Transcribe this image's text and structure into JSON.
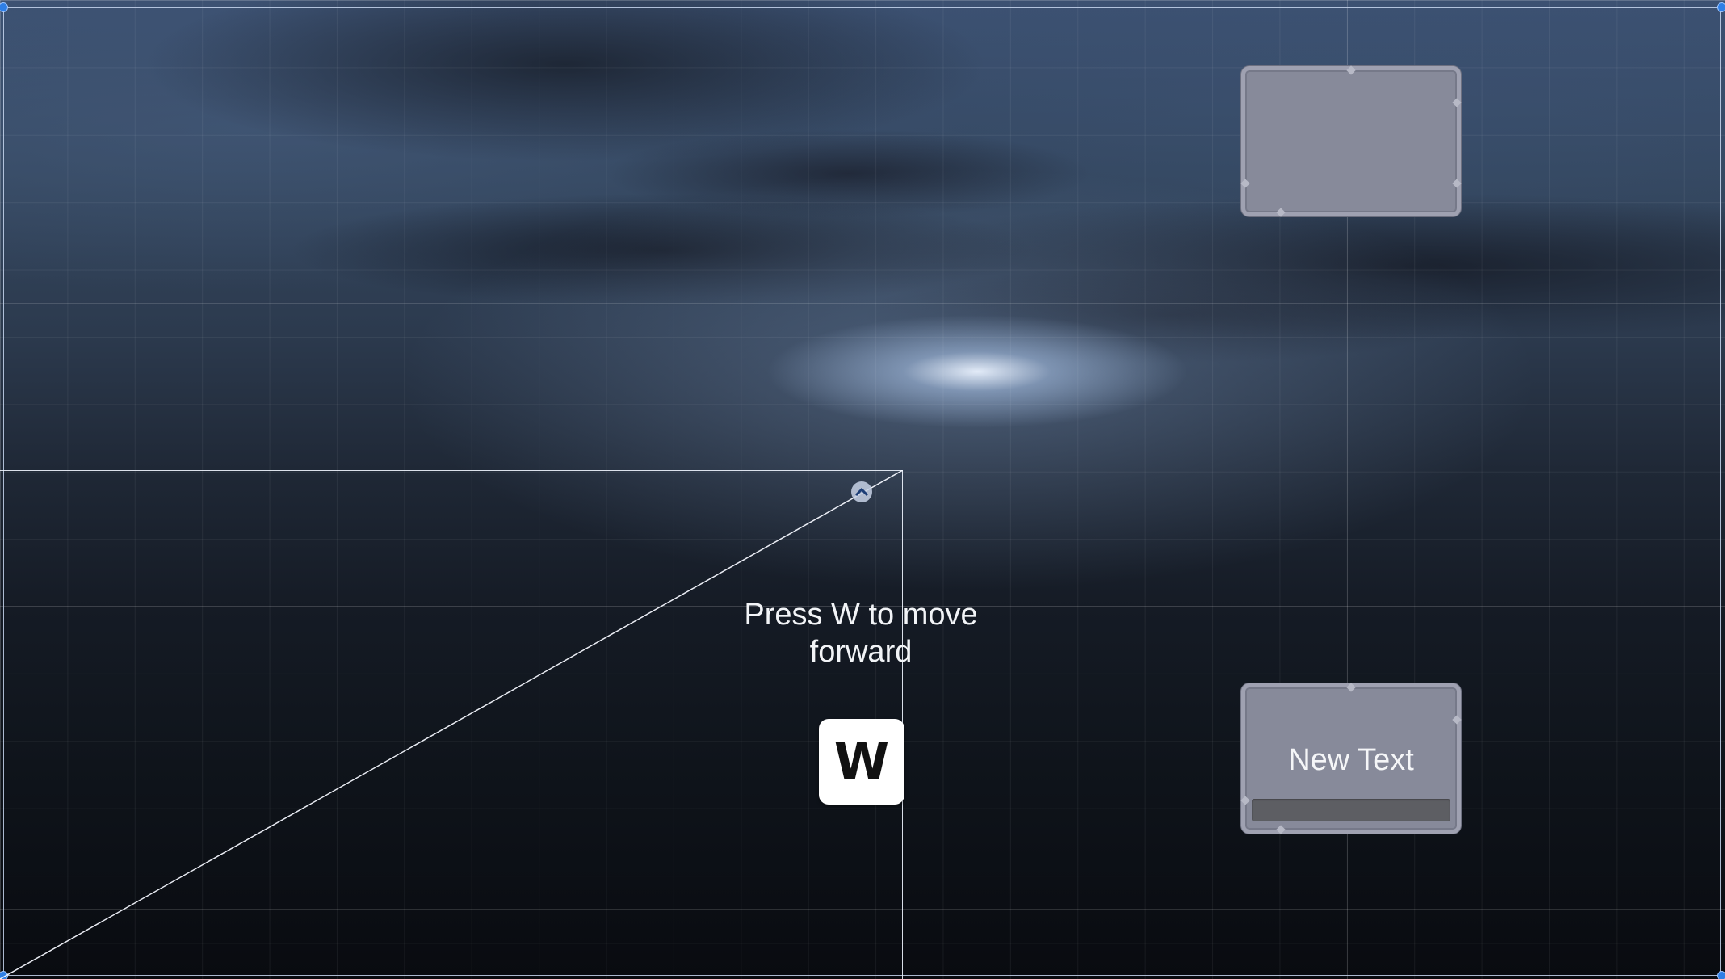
{
  "prompt": {
    "text": "Press W to move forward"
  },
  "key_hint": {
    "key": "W"
  },
  "panels": {
    "top": {
      "text": ""
    },
    "bottom": {
      "text": "New Text"
    }
  },
  "colors": {
    "sky_top": "#3c5172",
    "sky_bottom": "#090b10",
    "panel_fill": "#878a9a",
    "panel_border": "#9fa1b1",
    "handle_blue": "#2f7fe6",
    "key_background": "#ffffff"
  }
}
